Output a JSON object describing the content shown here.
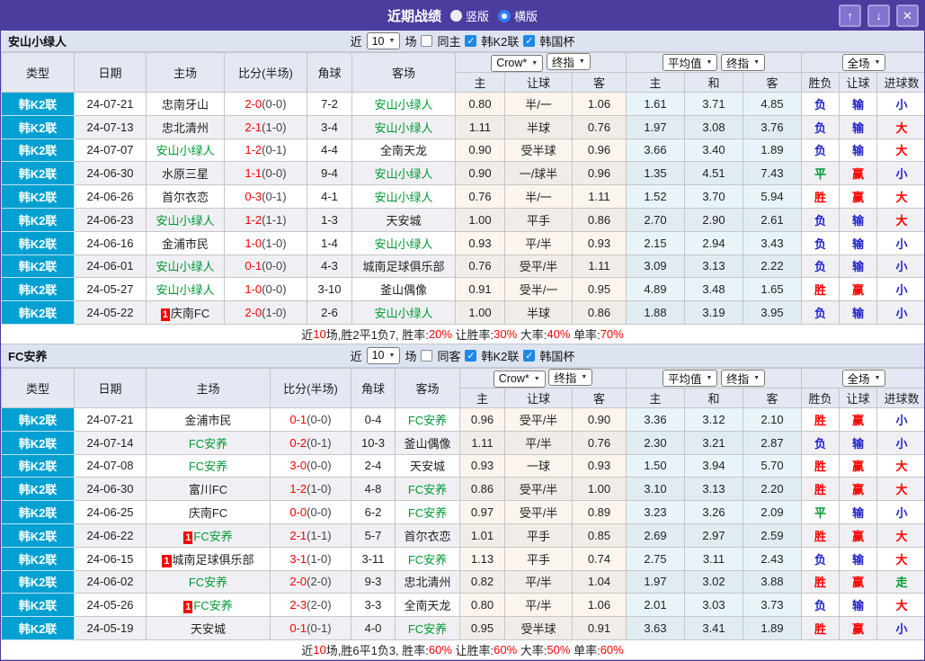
{
  "titlebar": {
    "title": "近期战绩",
    "vertical_label": "竖版",
    "horizontal_label": "横版",
    "up_icon": "↑",
    "down_icon": "↓",
    "close_icon": "✕"
  },
  "filter": {
    "near": "近",
    "count": "10",
    "games": "场",
    "k2": "韩K2联",
    "cup": "韩国杯"
  },
  "header": {
    "type": "类型",
    "date": "日期",
    "home": "主场",
    "score": "比分(半场)",
    "corner": "角球",
    "away": "客场",
    "crow": "Crow*",
    "final": "终指",
    "avg": "平均值",
    "final2": "终指",
    "fulltime": "全场",
    "home_odds": "主",
    "handicap": "让球",
    "away_odds": "客",
    "avg_home": "主",
    "avg_draw": "和",
    "avg_away": "客",
    "result": "胜负",
    "handicap_result": "让球",
    "goals": "进球数"
  },
  "colors": {
    "accent_purple": "#4b3d9e",
    "type_cyan": "#00a0d2",
    "win_red": "#ff0000",
    "lose_blue": "#2323cc",
    "draw_green": "#009933",
    "team_green": "#009933"
  },
  "sections": [
    {
      "team": "安山小绿人",
      "same_label": "同主",
      "rows": [
        {
          "league": "韩K2联",
          "date": "24-07-21",
          "home": "忠南牙山",
          "home_green": false,
          "badge": "",
          "score": "2-0",
          "half": "(0-0)",
          "corner": "7-2",
          "away": "安山小绿人",
          "away_green": true,
          "odds_home": "0.80",
          "handicap": "半/一",
          "odds_away": "1.06",
          "avg_home": "1.61",
          "avg_draw": "3.71",
          "avg_away": "4.85",
          "result": "负",
          "result_color": "blue",
          "handicap_result": "输",
          "handicap_result_color": "blue",
          "goals": "小",
          "goals_color": "blue"
        },
        {
          "league": "韩K2联",
          "date": "24-07-13",
          "home": "忠北清州",
          "home_green": false,
          "badge": "",
          "score": "2-1",
          "half": "(1-0)",
          "corner": "3-4",
          "away": "安山小绿人",
          "away_green": true,
          "odds_home": "1.11",
          "handicap": "半球",
          "odds_away": "0.76",
          "avg_home": "1.97",
          "avg_draw": "3.08",
          "avg_away": "3.76",
          "result": "负",
          "result_color": "blue",
          "handicap_result": "输",
          "handicap_result_color": "blue",
          "goals": "大",
          "goals_color": "red"
        },
        {
          "league": "韩K2联",
          "date": "24-07-07",
          "home": "安山小绿人",
          "home_green": true,
          "badge": "",
          "score": "1-2",
          "half": "(0-1)",
          "corner": "4-4",
          "away": "全南天龙",
          "away_green": false,
          "odds_home": "0.90",
          "handicap": "受半球",
          "odds_away": "0.96",
          "avg_home": "3.66",
          "avg_draw": "3.40",
          "avg_away": "1.89",
          "result": "负",
          "result_color": "blue",
          "handicap_result": "输",
          "handicap_result_color": "blue",
          "goals": "大",
          "goals_color": "red"
        },
        {
          "league": "韩K2联",
          "date": "24-06-30",
          "home": "水原三星",
          "home_green": false,
          "badge": "",
          "score": "1-1",
          "half": "(0-0)",
          "corner": "9-4",
          "away": "安山小绿人",
          "away_green": true,
          "odds_home": "0.90",
          "handicap": "一/球半",
          "odds_away": "0.96",
          "avg_home": "1.35",
          "avg_draw": "4.51",
          "avg_away": "7.43",
          "result": "平",
          "result_color": "green",
          "handicap_result": "赢",
          "handicap_result_color": "red",
          "goals": "小",
          "goals_color": "blue"
        },
        {
          "league": "韩K2联",
          "date": "24-06-26",
          "home": "首尔衣恋",
          "home_green": false,
          "badge": "",
          "score": "0-3",
          "half": "(0-1)",
          "corner": "4-1",
          "away": "安山小绿人",
          "away_green": true,
          "odds_home": "0.76",
          "handicap": "半/一",
          "odds_away": "1.11",
          "avg_home": "1.52",
          "avg_draw": "3.70",
          "avg_away": "5.94",
          "result": "胜",
          "result_color": "red",
          "handicap_result": "赢",
          "handicap_result_color": "red",
          "goals": "大",
          "goals_color": "red"
        },
        {
          "league": "韩K2联",
          "date": "24-06-23",
          "home": "安山小绿人",
          "home_green": true,
          "badge": "",
          "score": "1-2",
          "half": "(1-1)",
          "corner": "1-3",
          "away": "天安城",
          "away_green": false,
          "odds_home": "1.00",
          "handicap": "平手",
          "odds_away": "0.86",
          "avg_home": "2.70",
          "avg_draw": "2.90",
          "avg_away": "2.61",
          "result": "负",
          "result_color": "blue",
          "handicap_result": "输",
          "handicap_result_color": "blue",
          "goals": "大",
          "goals_color": "red"
        },
        {
          "league": "韩K2联",
          "date": "24-06-16",
          "home": "金浦市民",
          "home_green": false,
          "badge": "",
          "score": "1-0",
          "half": "(1-0)",
          "corner": "1-4",
          "away": "安山小绿人",
          "away_green": true,
          "odds_home": "0.93",
          "handicap": "平/半",
          "odds_away": "0.93",
          "avg_home": "2.15",
          "avg_draw": "2.94",
          "avg_away": "3.43",
          "result": "负",
          "result_color": "blue",
          "handicap_result": "输",
          "handicap_result_color": "blue",
          "goals": "小",
          "goals_color": "blue"
        },
        {
          "league": "韩K2联",
          "date": "24-06-01",
          "home": "安山小绿人",
          "home_green": true,
          "badge": "",
          "score": "0-1",
          "half": "(0-0)",
          "corner": "4-3",
          "away": "城南足球俱乐部",
          "away_green": false,
          "odds_home": "0.76",
          "handicap": "受平/半",
          "odds_away": "1.11",
          "avg_home": "3.09",
          "avg_draw": "3.13",
          "avg_away": "2.22",
          "result": "负",
          "result_color": "blue",
          "handicap_result": "输",
          "handicap_result_color": "blue",
          "goals": "小",
          "goals_color": "blue"
        },
        {
          "league": "韩K2联",
          "date": "24-05-27",
          "home": "安山小绿人",
          "home_green": true,
          "badge": "",
          "score": "1-0",
          "half": "(0-0)",
          "corner": "3-10",
          "away": "釜山偶像",
          "away_green": false,
          "odds_home": "0.91",
          "handicap": "受半/一",
          "odds_away": "0.95",
          "avg_home": "4.89",
          "avg_draw": "3.48",
          "avg_away": "1.65",
          "result": "胜",
          "result_color": "red",
          "handicap_result": "赢",
          "handicap_result_color": "red",
          "goals": "小",
          "goals_color": "blue"
        },
        {
          "league": "韩K2联",
          "date": "24-05-22",
          "home": "庆南FC",
          "home_green": false,
          "badge": "1",
          "score": "2-0",
          "half": "(1-0)",
          "corner": "2-6",
          "away": "安山小绿人",
          "away_green": true,
          "odds_home": "1.00",
          "handicap": "半球",
          "odds_away": "0.86",
          "avg_home": "1.88",
          "avg_draw": "3.19",
          "avg_away": "3.95",
          "result": "负",
          "result_color": "blue",
          "handicap_result": "输",
          "handicap_result_color": "blue",
          "goals": "小",
          "goals_color": "blue"
        }
      ],
      "summary": {
        "p1": "近",
        "n1": "10",
        "p2": "场,胜2平1负7, 胜率:",
        "v1": "20%",
        "p3": " 让胜率:",
        "v2": "30%",
        "p4": " 大率:",
        "v3": "40%",
        "p5": " 单率:",
        "v4": "70%"
      }
    },
    {
      "team": "FC安养",
      "same_label": "同客",
      "rows": [
        {
          "league": "韩K2联",
          "date": "24-07-21",
          "home": "金浦市民",
          "home_green": false,
          "badge": "",
          "score": "0-1",
          "half": "(0-0)",
          "corner": "0-4",
          "away": "FC安养",
          "away_green": true,
          "odds_home": "0.96",
          "handicap": "受平/半",
          "odds_away": "0.90",
          "avg_home": "3.36",
          "avg_draw": "3.12",
          "avg_away": "2.10",
          "result": "胜",
          "result_color": "red",
          "handicap_result": "赢",
          "handicap_result_color": "red",
          "goals": "小",
          "goals_color": "blue"
        },
        {
          "league": "韩K2联",
          "date": "24-07-14",
          "home": "FC安养",
          "home_green": true,
          "badge": "",
          "score": "0-2",
          "half": "(0-1)",
          "corner": "10-3",
          "away": "釜山偶像",
          "away_green": false,
          "odds_home": "1.11",
          "handicap": "平/半",
          "odds_away": "0.76",
          "avg_home": "2.30",
          "avg_draw": "3.21",
          "avg_away": "2.87",
          "result": "负",
          "result_color": "blue",
          "handicap_result": "输",
          "handicap_result_color": "blue",
          "goals": "小",
          "goals_color": "blue"
        },
        {
          "league": "韩K2联",
          "date": "24-07-08",
          "home": "FC安养",
          "home_green": true,
          "badge": "",
          "score": "3-0",
          "half": "(0-0)",
          "corner": "2-4",
          "away": "天安城",
          "away_green": false,
          "odds_home": "0.93",
          "handicap": "一球",
          "odds_away": "0.93",
          "avg_home": "1.50",
          "avg_draw": "3.94",
          "avg_away": "5.70",
          "result": "胜",
          "result_color": "red",
          "handicap_result": "赢",
          "handicap_result_color": "red",
          "goals": "大",
          "goals_color": "red"
        },
        {
          "league": "韩K2联",
          "date": "24-06-30",
          "home": "富川FC",
          "home_green": false,
          "badge": "",
          "score": "1-2",
          "half": "(1-0)",
          "corner": "4-8",
          "away": "FC安养",
          "away_green": true,
          "odds_home": "0.86",
          "handicap": "受平/半",
          "odds_away": "1.00",
          "avg_home": "3.10",
          "avg_draw": "3.13",
          "avg_away": "2.20",
          "result": "胜",
          "result_color": "red",
          "handicap_result": "赢",
          "handicap_result_color": "red",
          "goals": "大",
          "goals_color": "red"
        },
        {
          "league": "韩K2联",
          "date": "24-06-25",
          "home": "庆南FC",
          "home_green": false,
          "badge": "",
          "score": "0-0",
          "half": "(0-0)",
          "corner": "6-2",
          "away": "FC安养",
          "away_green": true,
          "odds_home": "0.97",
          "handicap": "受平/半",
          "odds_away": "0.89",
          "avg_home": "3.23",
          "avg_draw": "3.26",
          "avg_away": "2.09",
          "result": "平",
          "result_color": "green",
          "handicap_result": "输",
          "handicap_result_color": "blue",
          "goals": "小",
          "goals_color": "blue"
        },
        {
          "league": "韩K2联",
          "date": "24-06-22",
          "home": "FC安养",
          "home_green": true,
          "badge": "1",
          "score": "2-1",
          "half": "(1-1)",
          "corner": "5-7",
          "away": "首尔衣恋",
          "away_green": false,
          "odds_home": "1.01",
          "handicap": "平手",
          "odds_away": "0.85",
          "avg_home": "2.69",
          "avg_draw": "2.97",
          "avg_away": "2.59",
          "result": "胜",
          "result_color": "red",
          "handicap_result": "赢",
          "handicap_result_color": "red",
          "goals": "大",
          "goals_color": "red"
        },
        {
          "league": "韩K2联",
          "date": "24-06-15",
          "home": "城南足球俱乐部",
          "home_green": false,
          "badge": "1",
          "score": "3-1",
          "half": "(1-0)",
          "corner": "3-11",
          "away": "FC安养",
          "away_green": true,
          "odds_home": "1.13",
          "handicap": "平手",
          "odds_away": "0.74",
          "avg_home": "2.75",
          "avg_draw": "3.11",
          "avg_away": "2.43",
          "result": "负",
          "result_color": "blue",
          "handicap_result": "输",
          "handicap_result_color": "blue",
          "goals": "大",
          "goals_color": "red"
        },
        {
          "league": "韩K2联",
          "date": "24-06-02",
          "home": "FC安养",
          "home_green": true,
          "badge": "",
          "score": "2-0",
          "half": "(2-0)",
          "corner": "9-3",
          "away": "忠北清州",
          "away_green": false,
          "odds_home": "0.82",
          "handicap": "平/半",
          "odds_away": "1.04",
          "avg_home": "1.97",
          "avg_draw": "3.02",
          "avg_away": "3.88",
          "result": "胜",
          "result_color": "red",
          "handicap_result": "赢",
          "handicap_result_color": "red",
          "goals": "走",
          "goals_color": "green"
        },
        {
          "league": "韩K2联",
          "date": "24-05-26",
          "home": "FC安养",
          "home_green": true,
          "badge": "1",
          "score": "2-3",
          "half": "(2-0)",
          "corner": "3-3",
          "away": "全南天龙",
          "away_green": false,
          "odds_home": "0.80",
          "handicap": "平/半",
          "odds_away": "1.06",
          "avg_home": "2.01",
          "avg_draw": "3.03",
          "avg_away": "3.73",
          "result": "负",
          "result_color": "blue",
          "handicap_result": "输",
          "handicap_result_color": "blue",
          "goals": "大",
          "goals_color": "red"
        },
        {
          "league": "韩K2联",
          "date": "24-05-19",
          "home": "天安城",
          "home_green": false,
          "badge": "",
          "score": "0-1",
          "half": "(0-1)",
          "corner": "4-0",
          "away": "FC安养",
          "away_green": true,
          "odds_home": "0.95",
          "handicap": "受半球",
          "odds_away": "0.91",
          "avg_home": "3.63",
          "avg_draw": "3.41",
          "avg_away": "1.89",
          "result": "胜",
          "result_color": "red",
          "handicap_result": "赢",
          "handicap_result_color": "red",
          "goals": "小",
          "goals_color": "blue"
        }
      ],
      "summary": {
        "p1": "近",
        "n1": "10",
        "p2": "场,胜6平1负3, 胜率:",
        "v1": "60%",
        "p3": " 让胜率:",
        "v2": "60%",
        "p4": " 大率:",
        "v3": "50%",
        "p5": " 单率:",
        "v4": "60%"
      }
    }
  ]
}
